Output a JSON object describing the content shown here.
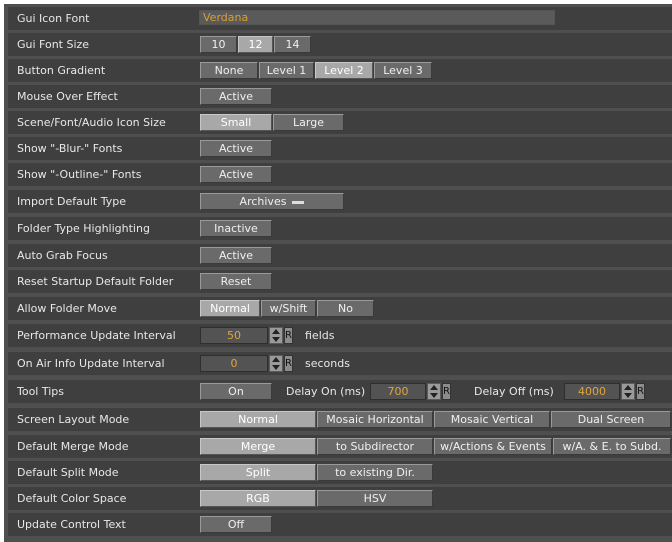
{
  "rows": {
    "gui_icon_font": {
      "label": "Gui Icon Font",
      "value": "Verdana"
    },
    "gui_font_size": {
      "label": "Gui Font Size",
      "options": [
        "10",
        "12",
        "14"
      ]
    },
    "button_gradient": {
      "label": "Button Gradient",
      "options": [
        "None",
        "Level 1",
        "Level 2",
        "Level 3"
      ]
    },
    "mouse_over_effect": {
      "label": "Mouse Over Effect",
      "button": "Active"
    },
    "icon_size": {
      "label": "Scene/Font/Audio Icon Size",
      "options": [
        "Small",
        "Large"
      ]
    },
    "show_blur": {
      "label": "Show \"-Blur-\" Fonts",
      "button": "Active"
    },
    "show_outline": {
      "label": "Show \"-Outline-\" Fonts",
      "button": "Active"
    },
    "import_default_type": {
      "label": "Import Default Type",
      "value": "Archives"
    },
    "folder_type_highlighting": {
      "label": "Folder Type Highlighting",
      "button": "Inactive"
    },
    "auto_grab_focus": {
      "label": "Auto Grab Focus",
      "button": "Active"
    },
    "reset_startup_folder": {
      "label": "Reset Startup Default Folder",
      "button": "Reset"
    },
    "allow_folder_move": {
      "label": "Allow Folder Move",
      "options": [
        "Normal",
        "w/Shift",
        "No"
      ]
    },
    "performance_update": {
      "label": "Performance Update Interval",
      "value": "50",
      "reset": "R",
      "unit": "fields"
    },
    "on_air_update": {
      "label": "On Air Info Update Interval",
      "value": "0",
      "reset": "R",
      "unit": "seconds"
    },
    "tool_tips": {
      "label": "Tool Tips",
      "button": "On",
      "delay_on_label": "Delay On (ms)",
      "delay_on_value": "700",
      "delay_off_label": "Delay Off (ms)",
      "delay_off_value": "4000",
      "reset": "R"
    },
    "screen_layout": {
      "label": "Screen Layout Mode",
      "options": [
        "Normal",
        "Mosaic Horizontal",
        "Mosaic Vertical",
        "Dual Screen"
      ]
    },
    "merge_mode": {
      "label": "Default Merge Mode",
      "options": [
        "Merge",
        "to Subdirector",
        "w/Actions & Events",
        "w/A. & E. to Subd."
      ]
    },
    "split_mode": {
      "label": "Default Split Mode",
      "options": [
        "Split",
        "to existing Dir."
      ]
    },
    "color_space": {
      "label": "Default Color Space",
      "options": [
        "RGB",
        "HSV"
      ]
    },
    "update_control_text": {
      "label": "Update Control Text",
      "button": "Off"
    }
  }
}
